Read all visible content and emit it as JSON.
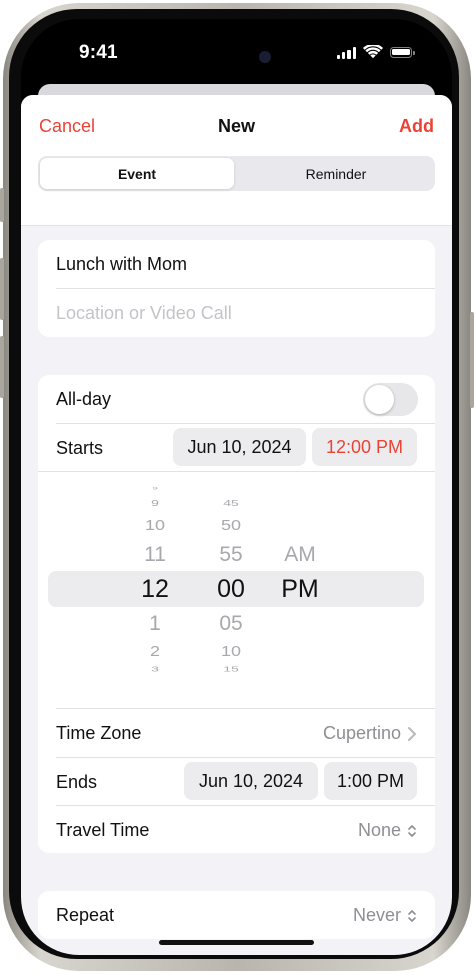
{
  "status": {
    "time": "9:41"
  },
  "header": {
    "cancel": "Cancel",
    "title": "New",
    "add": "Add"
  },
  "segment": {
    "event": "Event",
    "reminder": "Reminder"
  },
  "form": {
    "title_value": "Lunch with Mom",
    "location_placeholder": "Location or Video Call"
  },
  "schedule": {
    "allday_label": "All-day",
    "allday_on": false,
    "starts_label": "Starts",
    "starts_date": "Jun 10, 2024",
    "starts_time": "12:00 PM",
    "timezone_label": "Time Zone",
    "timezone_value": "Cupertino",
    "ends_label": "Ends",
    "ends_date": "Jun 10, 2024",
    "ends_time": "1:00 PM",
    "travel_label": "Travel Time",
    "travel_value": "None"
  },
  "picker": {
    "hours": [
      "9",
      "10",
      "11",
      "12",
      "1",
      "2",
      "3"
    ],
    "minutes": [
      "45",
      "50",
      "55",
      "00",
      "05",
      "10",
      "15"
    ],
    "ampm": [
      "AM",
      "PM"
    ]
  },
  "repeat": {
    "label": "Repeat",
    "value": "Never"
  },
  "colors": {
    "accent": "#ea4335",
    "background": "#f2f2f7"
  }
}
